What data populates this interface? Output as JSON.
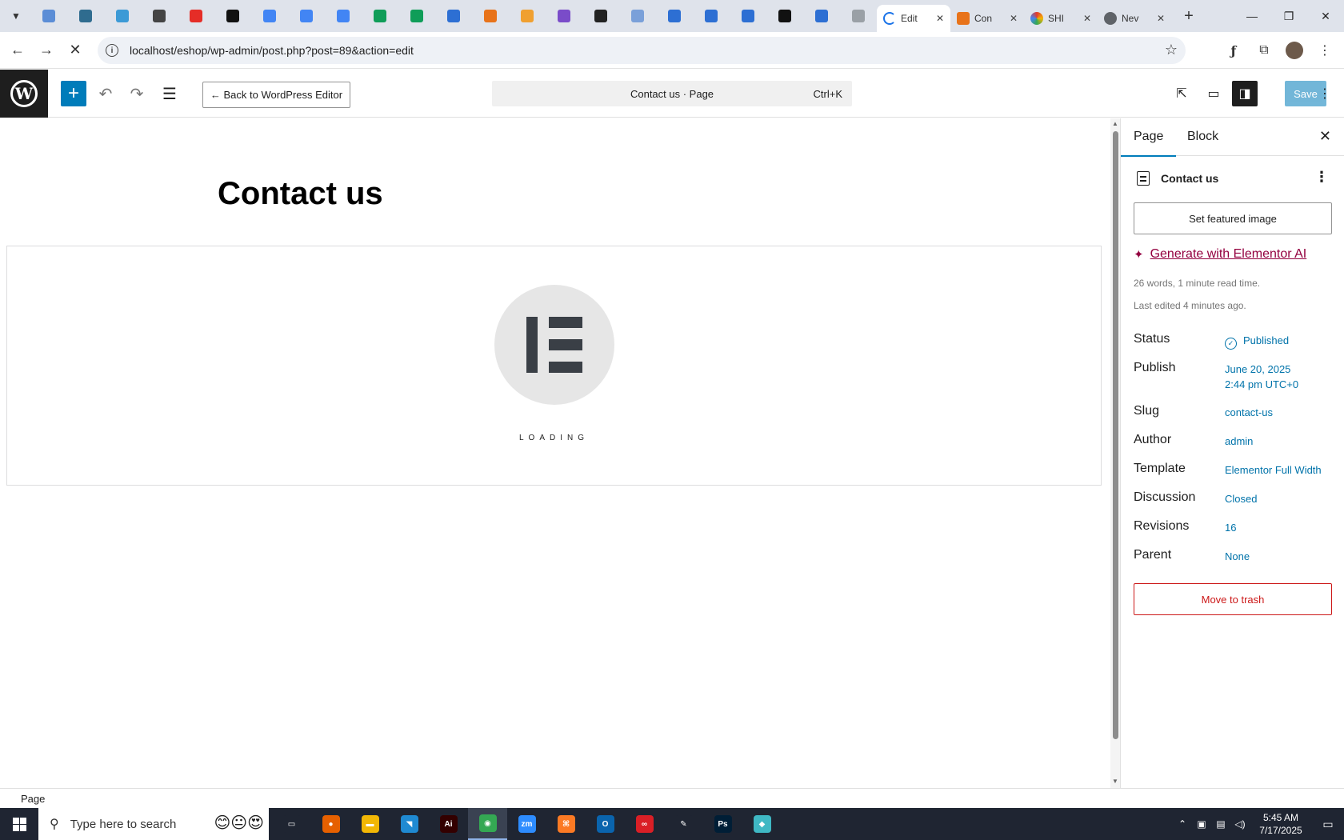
{
  "browser": {
    "tabs": [
      {
        "label": "Edit",
        "active": true,
        "color": "#1a73e8"
      },
      {
        "label": "Con",
        "active": false,
        "color": "#e8731a"
      },
      {
        "label": "SHI",
        "active": false,
        "color": "#e33b2e"
      },
      {
        "label": "Nev",
        "active": false,
        "color": "#5f6368"
      }
    ],
    "pinned_colors": [
      "#5b8dd6",
      "#2f6c8f",
      "#3c9ad6",
      "#444444",
      "#e52d27",
      "#111111",
      "#4285f4",
      "#4285f4",
      "#4285f4",
      "#0f9d58",
      "#0f9d58",
      "#2d6fd3",
      "#e8731a",
      "#f0a030",
      "#7a4cc9",
      "#222222",
      "#7aa0d9",
      "#2d6fd3",
      "#2d6fd3",
      "#2d6fd3",
      "#111111",
      "#2d6fd3",
      "#9aa0a6"
    ],
    "url": "localhost/eshop/wp-admin/post.php?post=89&action=edit"
  },
  "editor": {
    "back_label": "← Back to WordPress Editor",
    "command_title": "Contact us · Page",
    "command_shortcut": "Ctrl+K",
    "save_label": "Save"
  },
  "canvas": {
    "title": "Contact us",
    "loading_text": "LOADING"
  },
  "sidebar": {
    "tab_page": "Page",
    "tab_block": "Block",
    "doc_title": "Contact us",
    "featured_label": "Set featured image",
    "generate_ai_label": "Generate with Elementor AI",
    "words_text": "26 words, 1 minute read time.",
    "edited_text": "Last edited 4 minutes ago.",
    "status_key": "Status",
    "status_val": "Published",
    "publish_key": "Publish",
    "publish_date": "June 20, 2025",
    "publish_time": "2:44 pm UTC+0",
    "slug_key": "Slug",
    "slug_val": "contact-us",
    "author_key": "Author",
    "author_val": "admin",
    "template_key": "Template",
    "template_val": "Elementor Full Width",
    "discussion_key": "Discussion",
    "discussion_val": "Closed",
    "revisions_key": "Revisions",
    "revisions_val": "16",
    "parent_key": "Parent",
    "parent_val": "None",
    "trash_label": "Move to trash"
  },
  "footer": {
    "breadcrumb": "Page"
  },
  "taskbar": {
    "search_placeholder": "Type here to search",
    "time": "5:45 AM",
    "date": "7/17/2025",
    "apps": [
      {
        "name": "task-view",
        "color": "#1f2532",
        "glyph": "▭"
      },
      {
        "name": "firefox",
        "color": "#e66000",
        "glyph": "●"
      },
      {
        "name": "file-explorer",
        "color": "#f2b705",
        "glyph": "▬"
      },
      {
        "name": "vscode",
        "color": "#1f8ad2",
        "glyph": "◥"
      },
      {
        "name": "illustrator",
        "color": "#330000",
        "glyph": "Ai"
      },
      {
        "name": "chrome",
        "color": "#34a853",
        "glyph": "◉"
      },
      {
        "name": "zoom",
        "color": "#2d8cff",
        "glyph": "zm"
      },
      {
        "name": "xampp",
        "color": "#fb7a24",
        "glyph": "⌘"
      },
      {
        "name": "outlook",
        "color": "#0a64ad",
        "glyph": "O"
      },
      {
        "name": "creative-cloud",
        "color": "#da1f26",
        "glyph": "∞"
      },
      {
        "name": "pen-tool",
        "color": "#1f2532",
        "glyph": "✎"
      },
      {
        "name": "photoshop",
        "color": "#001e36",
        "glyph": "Ps"
      },
      {
        "name": "app-diamond",
        "color": "#3fb8c4",
        "glyph": "◆"
      }
    ]
  }
}
